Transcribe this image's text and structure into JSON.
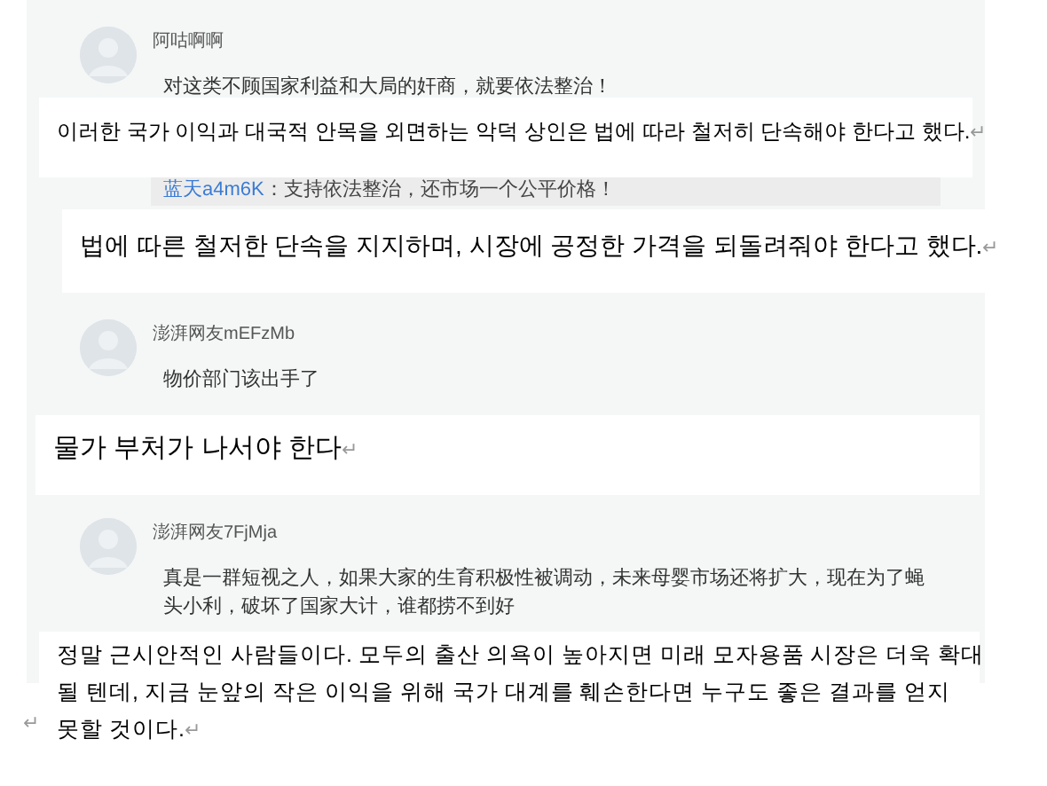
{
  "comments": [
    {
      "user": "阿咕啊啊",
      "lines": [
        "对这类不顾国家利益和大局的奸商，就要依法整治！"
      ]
    },
    {
      "user": "澎湃网友mEFzMb",
      "lines": [
        "物价部门该出手了"
      ]
    },
    {
      "user": "澎湃网友7FjMja",
      "lines": [
        "真是一群短视之人，如果大家的生育积极性被调动，未来母婴市场还将扩大，现在为了蝇",
        "头小利，破坏了国家大计，谁都捞不到好"
      ]
    }
  ],
  "reply_quote": {
    "user": "蓝天a4m6K",
    "text": "：支持依法整治，还市场一个公平价格！"
  },
  "translations": [
    {
      "lines": [
        "이러한 국가 이익과 대국적 안목을 외면하는 악덕 상인은 법에 따라 철저히 단속해야 한다고 했다."
      ],
      "end_mark": "↵"
    },
    {
      "lines": [
        "법에 따른 철저한 단속을 지지하며, 시장에 공정한 가격을 되돌려줘야 한다고 했다."
      ],
      "end_mark": "↵"
    },
    {
      "lines": [
        "물가 부처가 나서야 한다"
      ],
      "end_mark": "↵"
    },
    {
      "lines": [
        "정말 근시안적인 사람들이다. 모두의 출산 의욕이 높아지면 미래 모자용품 시장은 더욱 확대",
        "될 텐데, 지금 눈앞의 작은 이익을 위해 국가 대계를 훼손한다면 누구도 좋은 결과를 얻지",
        "못할 것이다."
      ],
      "end_mark": "↵"
    }
  ],
  "stray_mark": "↵"
}
